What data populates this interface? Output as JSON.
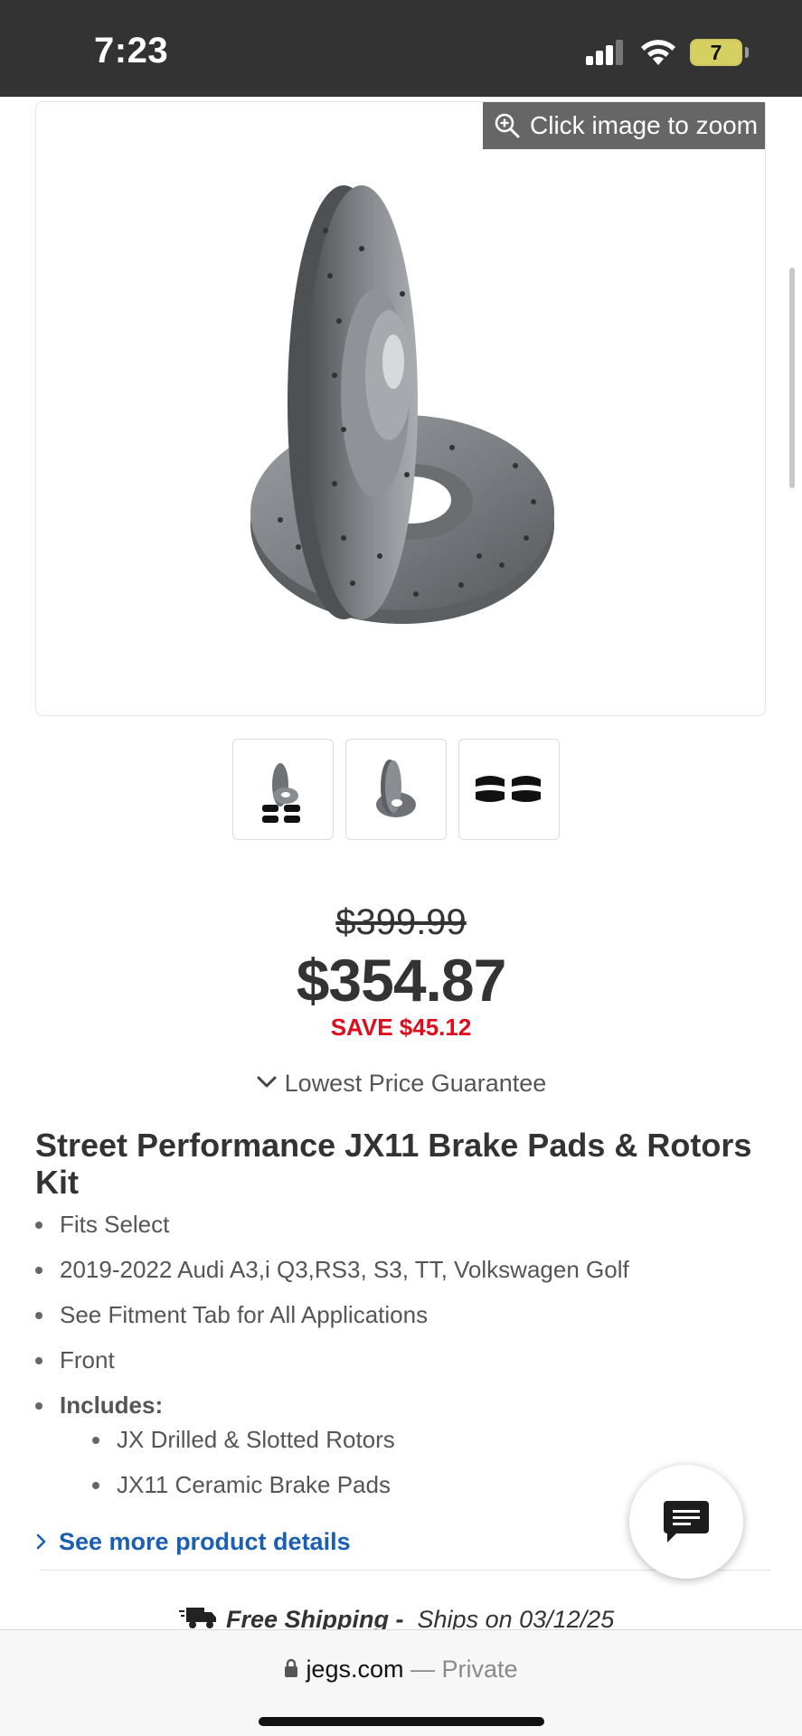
{
  "status_bar": {
    "time": "7:23",
    "battery": "7"
  },
  "gallery": {
    "zoom_label": "Click image to zoom",
    "thumbnails": [
      "rotors-and-pads-thumbnail",
      "rotors-thumbnail",
      "brake-pads-thumbnail"
    ]
  },
  "pricing": {
    "original_price": "$399.99",
    "sale_price": "$354.87",
    "savings": "SAVE $45.12",
    "guarantee": "Lowest Price Guarantee"
  },
  "product": {
    "title": "Street Performance JX11 Brake Pads & Rotors Kit",
    "bullets": [
      "Fits Select",
      "2019-2022 Audi A3,i Q3,RS3, S3, TT, Volkswagen Golf",
      "See Fitment Tab for All Applications",
      "Front",
      "Includes:"
    ],
    "includes": [
      "JX Drilled & Slotted Rotors",
      "JX11 Ceramic Brake Pads"
    ],
    "see_more": "See more product details"
  },
  "shipping": {
    "label": "Free Shipping -",
    "ships_on": "Ships on 03/12/25"
  },
  "browser": {
    "domain": "jegs.com",
    "mode": "— Private"
  },
  "colors": {
    "save_red": "#e00b1c",
    "link_blue": "#1a5fb4",
    "status_bar": "#333333"
  }
}
